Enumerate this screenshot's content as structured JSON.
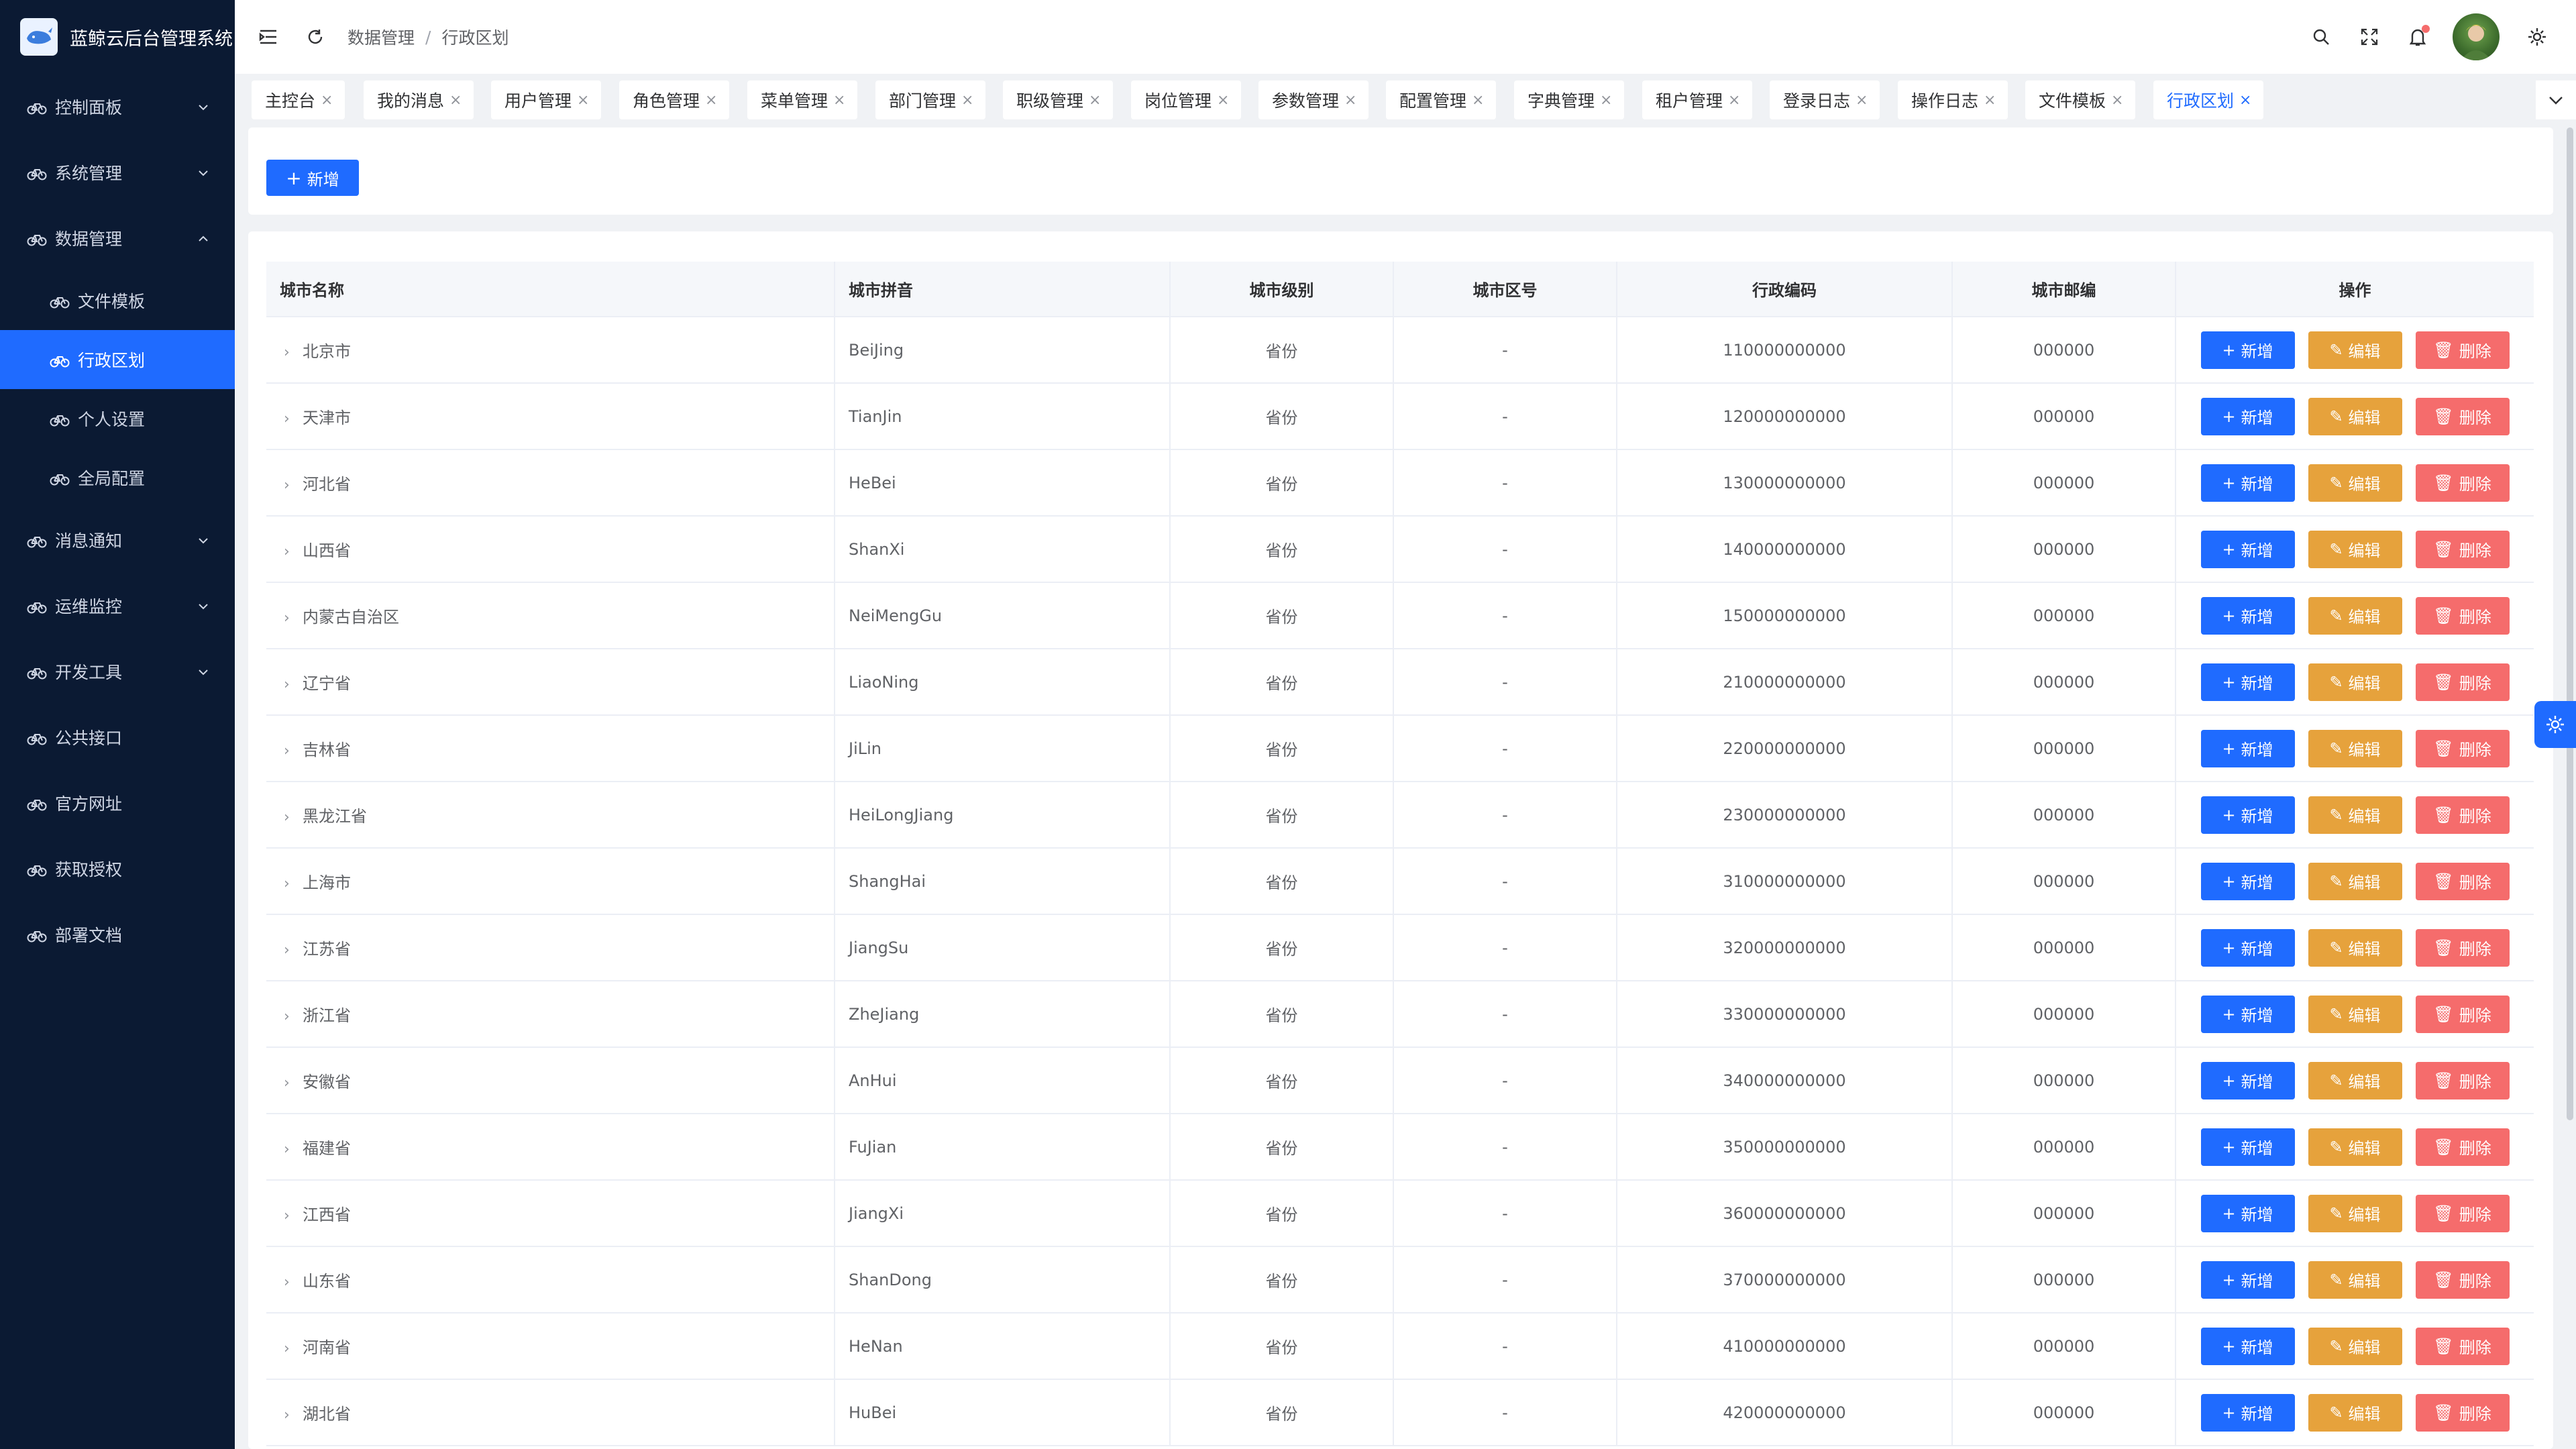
{
  "app": {
    "title": "蓝鲸云后台管理系统"
  },
  "sidebar": {
    "items": [
      {
        "label": "控制面板",
        "icon": "bike-icon",
        "has_children": true,
        "expanded": false
      },
      {
        "label": "系统管理",
        "icon": "bike-icon",
        "has_children": true,
        "expanded": false
      },
      {
        "label": "数据管理",
        "icon": "bike-icon",
        "has_children": true,
        "expanded": true,
        "children": [
          {
            "label": "文件模板",
            "active": false
          },
          {
            "label": "行政区划",
            "active": true
          },
          {
            "label": "个人设置",
            "active": false
          },
          {
            "label": "全局配置",
            "active": false
          }
        ]
      },
      {
        "label": "消息通知",
        "icon": "bike-icon",
        "has_children": true,
        "expanded": false
      },
      {
        "label": "运维监控",
        "icon": "bike-icon",
        "has_children": true,
        "expanded": false
      },
      {
        "label": "开发工具",
        "icon": "bike-icon",
        "has_children": true,
        "expanded": false
      },
      {
        "label": "公共接口",
        "icon": "bike-icon",
        "has_children": false
      },
      {
        "label": "官方网址",
        "icon": "bike-icon",
        "has_children": false
      },
      {
        "label": "获取授权",
        "icon": "bike-icon",
        "has_children": false
      },
      {
        "label": "部署文档",
        "icon": "bike-icon",
        "has_children": false
      }
    ]
  },
  "header": {
    "breadcrumb": [
      "数据管理",
      "行政区划"
    ],
    "breadcrumb_sep": "/"
  },
  "tabs": [
    {
      "label": "主控台",
      "active": false
    },
    {
      "label": "我的消息",
      "active": false
    },
    {
      "label": "用户管理",
      "active": false
    },
    {
      "label": "角色管理",
      "active": false
    },
    {
      "label": "菜单管理",
      "active": false
    },
    {
      "label": "部门管理",
      "active": false
    },
    {
      "label": "职级管理",
      "active": false
    },
    {
      "label": "岗位管理",
      "active": false
    },
    {
      "label": "参数管理",
      "active": false
    },
    {
      "label": "配置管理",
      "active": false
    },
    {
      "label": "字典管理",
      "active": false
    },
    {
      "label": "租户管理",
      "active": false
    },
    {
      "label": "登录日志",
      "active": false
    },
    {
      "label": "操作日志",
      "active": false
    },
    {
      "label": "文件模板",
      "active": false
    },
    {
      "label": "行政区划",
      "active": true
    }
  ],
  "toolbar": {
    "add_label": "新增"
  },
  "table": {
    "columns": [
      "城市名称",
      "城市拼音",
      "城市级别",
      "城市区号",
      "行政编码",
      "城市邮编",
      "操作"
    ],
    "actions": {
      "add": "新增",
      "edit": "编辑",
      "delete": "删除"
    },
    "rows": [
      {
        "name": "北京市",
        "pinyin": "BeiJing",
        "level": "省份",
        "area_code": "-",
        "admin_code": "110000000000",
        "postcode": "000000"
      },
      {
        "name": "天津市",
        "pinyin": "TianJin",
        "level": "省份",
        "area_code": "-",
        "admin_code": "120000000000",
        "postcode": "000000"
      },
      {
        "name": "河北省",
        "pinyin": "HeBei",
        "level": "省份",
        "area_code": "-",
        "admin_code": "130000000000",
        "postcode": "000000"
      },
      {
        "name": "山西省",
        "pinyin": "ShanXi",
        "level": "省份",
        "area_code": "-",
        "admin_code": "140000000000",
        "postcode": "000000"
      },
      {
        "name": "内蒙古自治区",
        "pinyin": "NeiMengGu",
        "level": "省份",
        "area_code": "-",
        "admin_code": "150000000000",
        "postcode": "000000"
      },
      {
        "name": "辽宁省",
        "pinyin": "LiaoNing",
        "level": "省份",
        "area_code": "-",
        "admin_code": "210000000000",
        "postcode": "000000"
      },
      {
        "name": "吉林省",
        "pinyin": "JiLin",
        "level": "省份",
        "area_code": "-",
        "admin_code": "220000000000",
        "postcode": "000000"
      },
      {
        "name": "黑龙江省",
        "pinyin": "HeiLongJiang",
        "level": "省份",
        "area_code": "-",
        "admin_code": "230000000000",
        "postcode": "000000"
      },
      {
        "name": "上海市",
        "pinyin": "ShangHai",
        "level": "省份",
        "area_code": "-",
        "admin_code": "310000000000",
        "postcode": "000000"
      },
      {
        "name": "江苏省",
        "pinyin": "JiangSu",
        "level": "省份",
        "area_code": "-",
        "admin_code": "320000000000",
        "postcode": "000000"
      },
      {
        "name": "浙江省",
        "pinyin": "ZheJiang",
        "level": "省份",
        "area_code": "-",
        "admin_code": "330000000000",
        "postcode": "000000"
      },
      {
        "name": "安徽省",
        "pinyin": "AnHui",
        "level": "省份",
        "area_code": "-",
        "admin_code": "340000000000",
        "postcode": "000000"
      },
      {
        "name": "福建省",
        "pinyin": "FuJian",
        "level": "省份",
        "area_code": "-",
        "admin_code": "350000000000",
        "postcode": "000000"
      },
      {
        "name": "江西省",
        "pinyin": "JiangXi",
        "level": "省份",
        "area_code": "-",
        "admin_code": "360000000000",
        "postcode": "000000"
      },
      {
        "name": "山东省",
        "pinyin": "ShanDong",
        "level": "省份",
        "area_code": "-",
        "admin_code": "370000000000",
        "postcode": "000000"
      },
      {
        "name": "河南省",
        "pinyin": "HeNan",
        "level": "省份",
        "area_code": "-",
        "admin_code": "410000000000",
        "postcode": "000000"
      },
      {
        "name": "湖北省",
        "pinyin": "HuBei",
        "level": "省份",
        "area_code": "-",
        "admin_code": "420000000000",
        "postcode": "000000"
      }
    ]
  },
  "colors": {
    "primary": "#1f6bff",
    "warning": "#e6a23c",
    "danger": "#f56c6c",
    "sidebar_bg": "#0b1a33"
  },
  "icons": {
    "header": [
      "menu-fold-icon",
      "refresh-icon",
      "search-icon",
      "fullscreen-icon",
      "bell-icon",
      "settings-icon"
    ]
  }
}
